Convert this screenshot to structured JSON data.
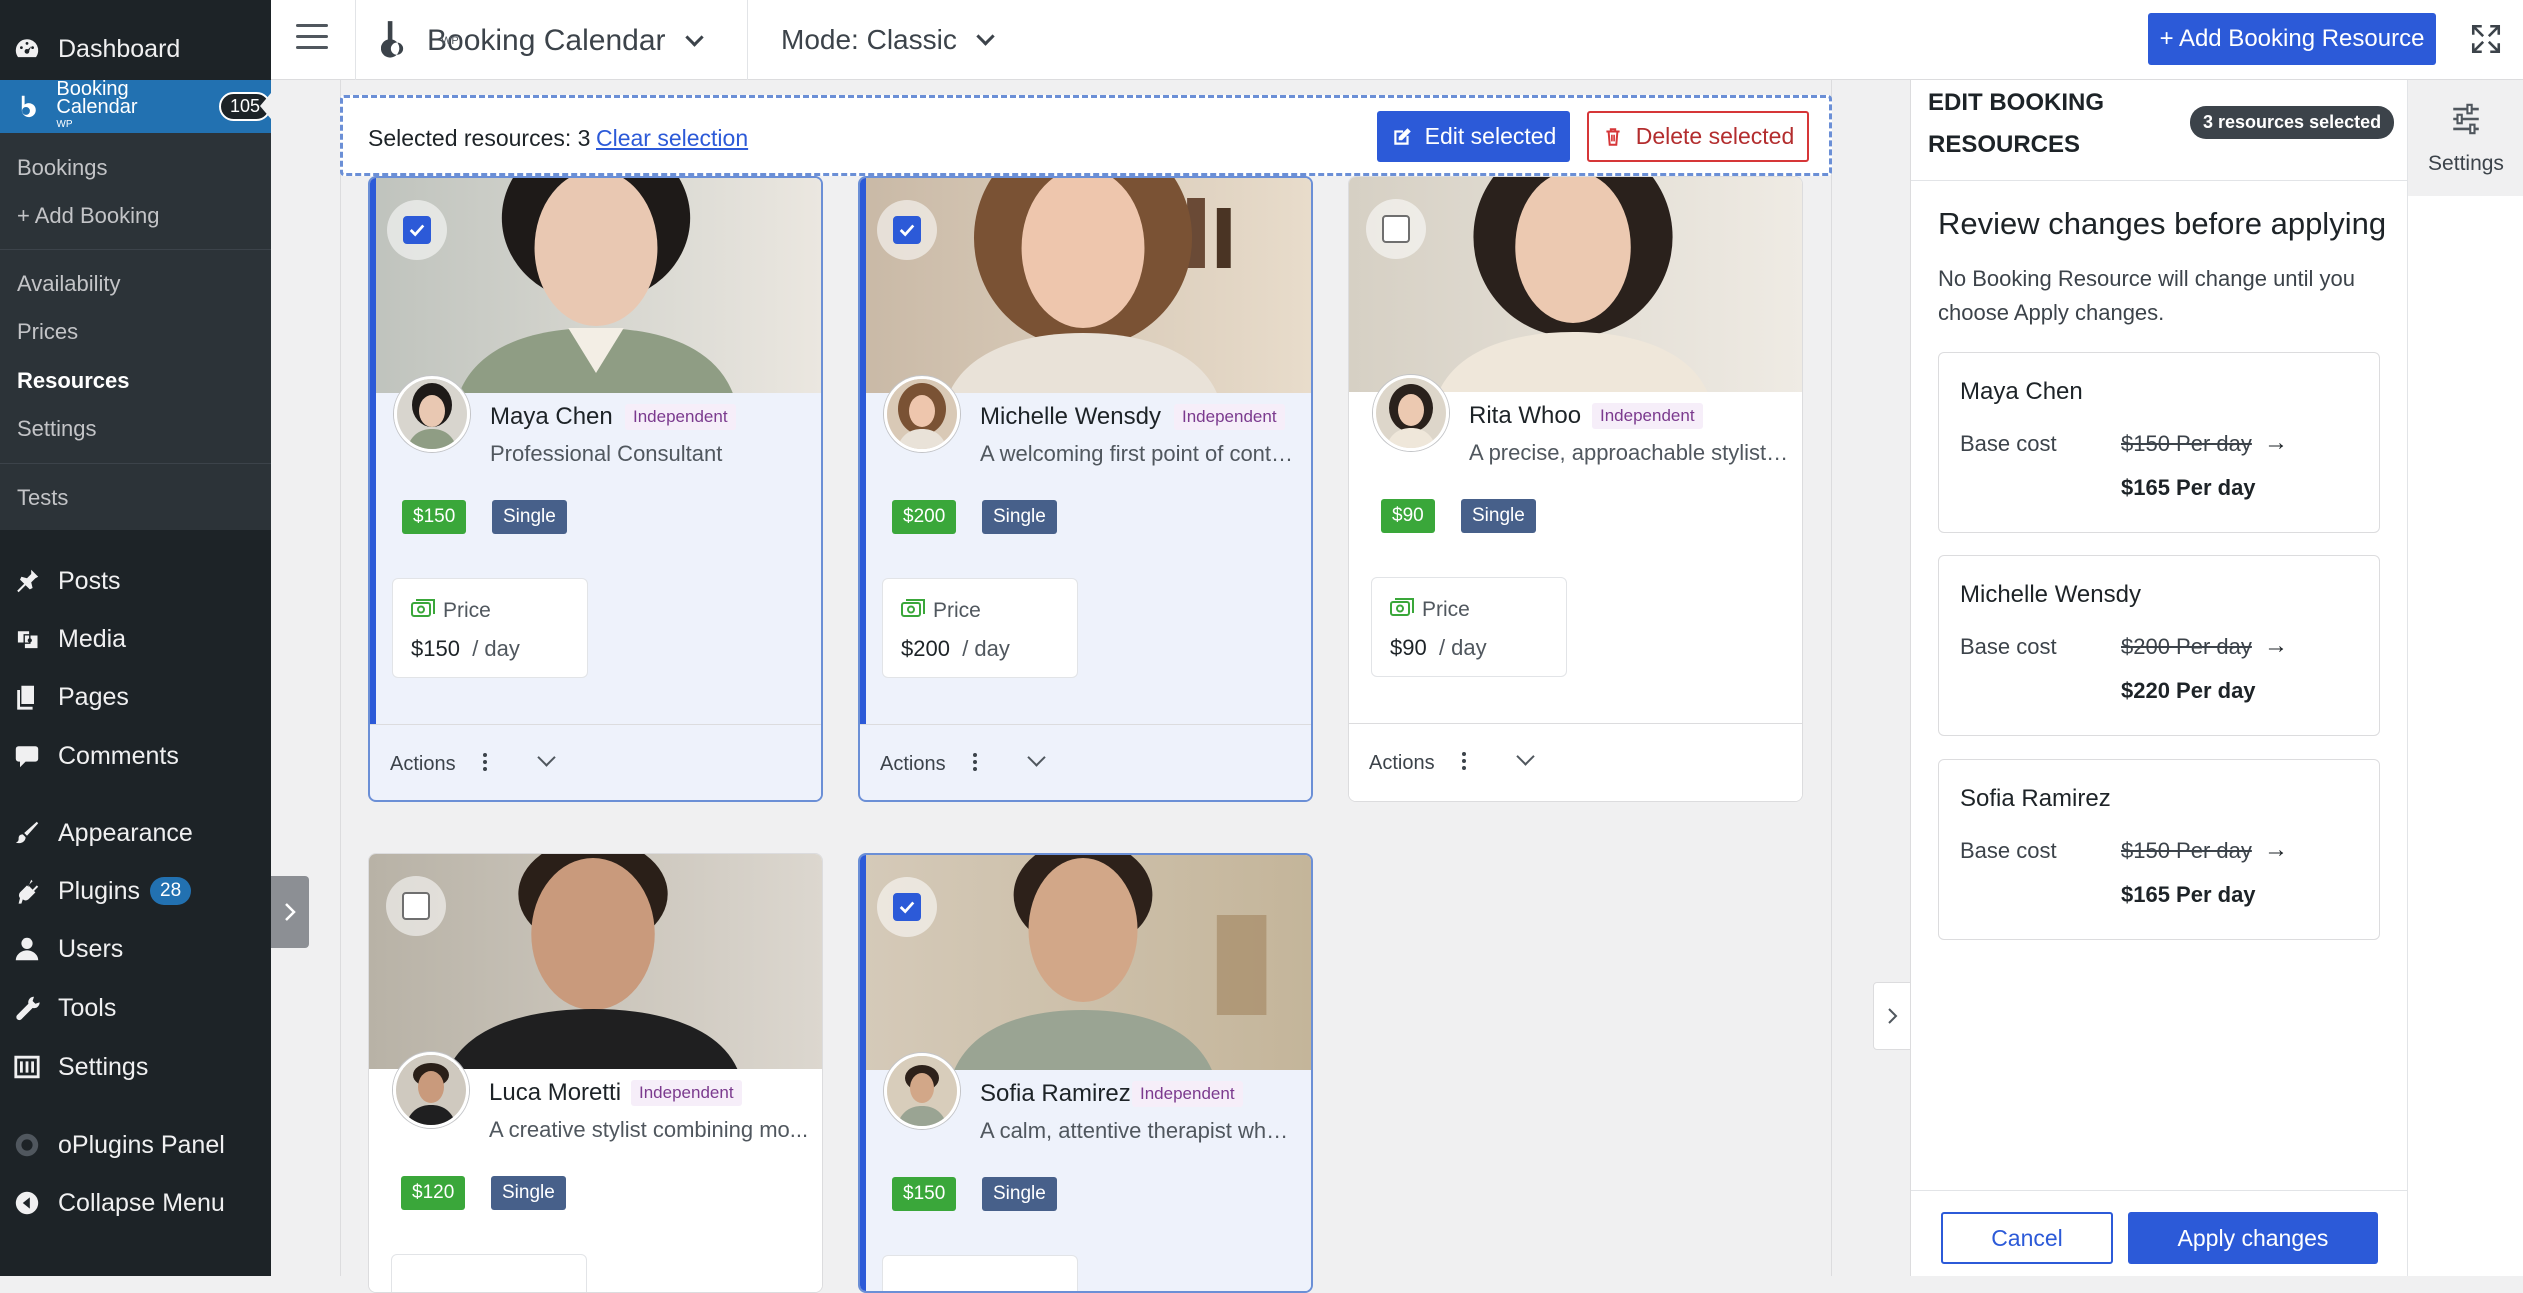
{
  "admin_menu": {
    "dashboard": "Dashboard",
    "booking_calendar": "Booking Calendar",
    "booking_calendar_sub": "WP",
    "booking_calendar_count": "105",
    "submenu": [
      "Bookings",
      "+ Add Booking",
      "Availability",
      "Prices",
      "Resources",
      "Settings",
      "Tests"
    ],
    "posts": "Posts",
    "media": "Media",
    "pages": "Pages",
    "comments": "Comments",
    "appearance": "Appearance",
    "plugins": "Plugins",
    "plugins_count": "28",
    "users": "Users",
    "tools": "Tools",
    "settings": "Settings",
    "oplugins": "oPlugins Panel",
    "collapse": "Collapse Menu"
  },
  "topbar": {
    "title": "Booking Calendar",
    "subtitle": "WP",
    "mode": "Mode: Classic",
    "add_resource": "+ Add Booking Resource"
  },
  "selection": {
    "text": "Selected resources: 3",
    "clear": "Clear selection",
    "edit": "Edit selected",
    "delete": "Delete selected"
  },
  "cards": [
    {
      "name": "Maya Chen",
      "type": "Independent",
      "desc": "Professional Consultant",
      "price_tag": "$150",
      "capacity": "Single",
      "price_label": "Price",
      "price": "$150",
      "unit": "/ day",
      "actions": "Actions",
      "selected": true
    },
    {
      "name": "Michelle Wensdy",
      "type": "Independent",
      "desc": "A welcoming first point of conta...",
      "price_tag": "$200",
      "capacity": "Single",
      "price_label": "Price",
      "price": "$200",
      "unit": "/ day",
      "actions": "Actions",
      "selected": true
    },
    {
      "name": "Rita Whoo",
      "type": "Independent",
      "desc": "A precise, approachable stylist s...",
      "price_tag": "$90",
      "capacity": "Single",
      "price_label": "Price",
      "price": "$90",
      "unit": "/ day",
      "actions": "Actions",
      "selected": false
    },
    {
      "name": "Luca Moretti",
      "type": "Independent",
      "desc": "A creative stylist combining mo...",
      "price_tag": "$120",
      "capacity": "Single",
      "selected": false
    },
    {
      "name": "Sofia Ramirez",
      "type": "Independent",
      "desc": "A calm, attentive therapist who ...",
      "price_tag": "$150",
      "capacity": "Single",
      "selected": true
    }
  ],
  "panel": {
    "title": "EDIT BOOKING RESOURCES",
    "badge": "3 resources selected",
    "review_title": "Review changes before applying",
    "review_sub": "No Booking Resource will change until you choose Apply changes.",
    "changes": [
      {
        "name": "Maya Chen",
        "label": "Base cost",
        "old": "$150 Per day",
        "arrow": "→",
        "new": "$165 Per day"
      },
      {
        "name": "Michelle Wensdy",
        "label": "Base cost",
        "old": "$200 Per day",
        "arrow": "→",
        "new": "$220 Per day"
      },
      {
        "name": "Sofia Ramirez",
        "label": "Base cost",
        "old": "$150 Per day",
        "arrow": "→",
        "new": "$165 Per day"
      }
    ],
    "cancel": "Cancel",
    "apply": "Apply changes"
  },
  "settings_tab": {
    "label": "Settings"
  },
  "colors": {
    "accent": "#2c5ad8",
    "wp_dark": "#1d2327",
    "price_green": "#3aa73a",
    "single_tag": "#47608a"
  }
}
